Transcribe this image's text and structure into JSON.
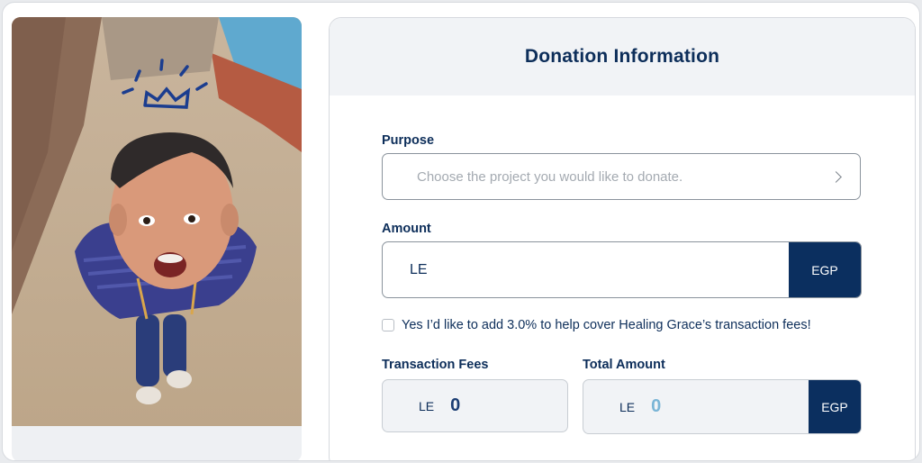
{
  "header": {
    "title": "Donation Information"
  },
  "purpose": {
    "label": "Purpose",
    "placeholder": "Choose the project you would like to donate.",
    "icon": "chevron-right-icon"
  },
  "amount": {
    "label": "Amount",
    "prefix": "LE",
    "currency": "EGP",
    "value": ""
  },
  "fee_option": {
    "checked": false,
    "text": "Yes I’d like to add 3.0% to help cover Healing Grace’s transaction fees!"
  },
  "transaction_fees": {
    "label": "Transaction Fees",
    "prefix": "LE",
    "value": "0"
  },
  "total_amount": {
    "label": "Total Amount",
    "prefix": "LE",
    "value": "0",
    "currency": "EGP"
  },
  "colors": {
    "navy": "#0b2f5f",
    "title": "#0d2e5a",
    "total_value": "#7ab5d6",
    "header_bg": "#f1f3f6"
  },
  "image": {
    "description_icon": "crown-doodle-icon"
  }
}
